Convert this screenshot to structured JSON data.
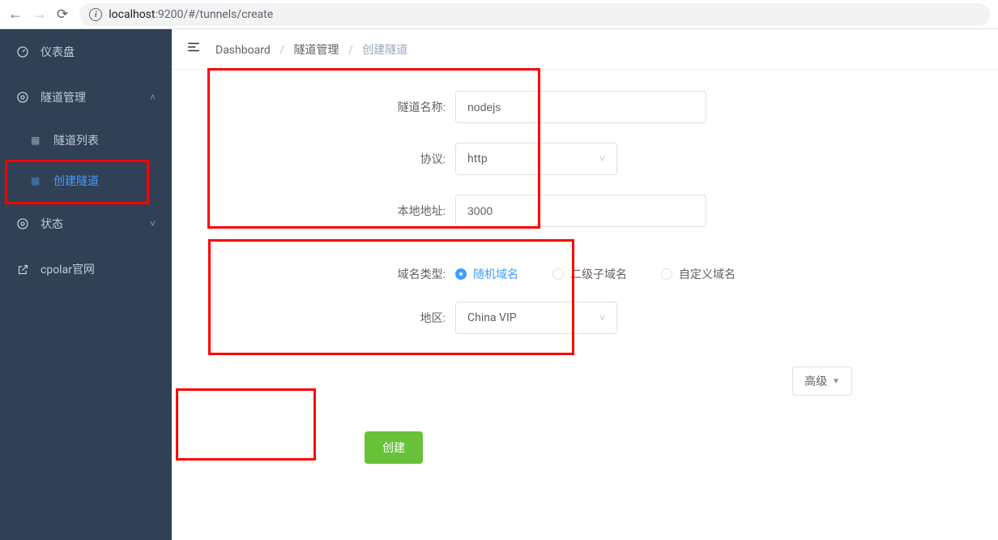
{
  "browser": {
    "url_host": "localhost",
    "url_port": ":9200",
    "url_path": "/#/tunnels/create"
  },
  "sidebar": {
    "items": [
      {
        "icon": "dashboard",
        "label": "仪表盘",
        "expandable": false
      },
      {
        "icon": "cog",
        "label": "隧道管理",
        "expandable": true,
        "expanded": true,
        "children": [
          {
            "label": "隧道列表",
            "active": false
          },
          {
            "label": "创建隧道",
            "active": true
          }
        ]
      },
      {
        "icon": "cog",
        "label": "状态",
        "expandable": true,
        "expanded": false
      },
      {
        "icon": "external",
        "label": "cpolar官网",
        "expandable": false
      }
    ]
  },
  "breadcrumb": {
    "items": [
      "Dashboard",
      "隧道管理",
      "创建隧道"
    ]
  },
  "form": {
    "tunnel_name": {
      "label": "隧道名称:",
      "value": "nodejs"
    },
    "protocol": {
      "label": "协议:",
      "value": "http"
    },
    "local_addr": {
      "label": "本地地址:",
      "value": "3000"
    },
    "domain_type": {
      "label": "域名类型:",
      "options": [
        {
          "label": "随机域名",
          "value": "random",
          "checked": true
        },
        {
          "label": "二级子域名",
          "value": "sub",
          "checked": false
        },
        {
          "label": "自定义域名",
          "value": "custom",
          "checked": false
        }
      ]
    },
    "region": {
      "label": "地区:",
      "value": "China VIP"
    },
    "advanced_button": "高级",
    "submit_button": "创建"
  }
}
